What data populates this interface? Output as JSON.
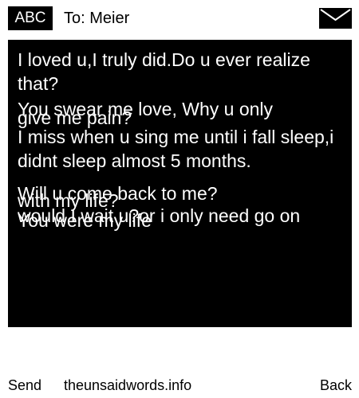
{
  "header": {
    "input_mode": "ABC",
    "recipient": "To: Meier",
    "envelope_icon": "envelope-icon"
  },
  "message": {
    "lines": [
      "I loved u,I truly did.Do u ever realize that?",
      "give me pain?",
      "You swear me love, Why u only",
      "I miss when u sing me until i fall sleep,i didnt sleep almost 5 months.",
      "with my life?",
      "Will u come back to me?",
      "would I wait u?or i only need go on",
      "You were my life"
    ]
  },
  "softkeys": {
    "left": "Send",
    "middle": "theunsaidwords.info",
    "right": "Back"
  },
  "colors": {
    "background": "#ffffff",
    "message_bg": "#000000",
    "message_text": "#ffffff"
  }
}
